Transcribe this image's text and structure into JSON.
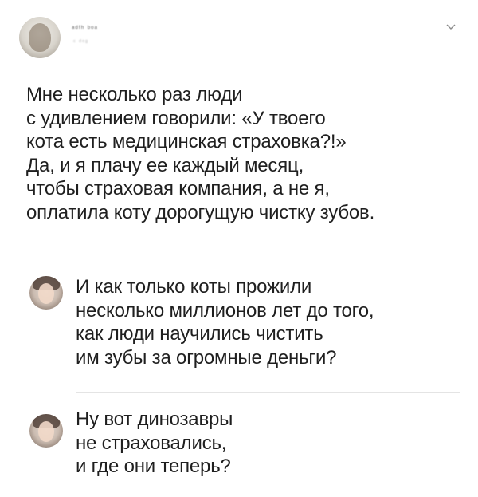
{
  "post": {
    "author": "ᵃᵈᶠʰ ᵇᵒᵃ",
    "handle": "ᶜ ᵈᵉᵍ",
    "lines": [
      "Мне несколько раз люди",
      "с удивлением говорили: «У твоего",
      "кота есть медицинская страховка?!»",
      "Да, и я плачу ее каждый месяц,",
      "чтобы страховая компания, а не я,",
      "оплатила коту дорогущую чистку зубов."
    ]
  },
  "replies": [
    {
      "lines": [
        "И как только коты прожили",
        "несколько миллионов лет до того,",
        "как люди научились чистить",
        "им зубы за огромные деньги?"
      ]
    },
    {
      "lines": [
        "Ну вот динозавры",
        "не страховались,",
        "и где они теперь?"
      ]
    }
  ]
}
